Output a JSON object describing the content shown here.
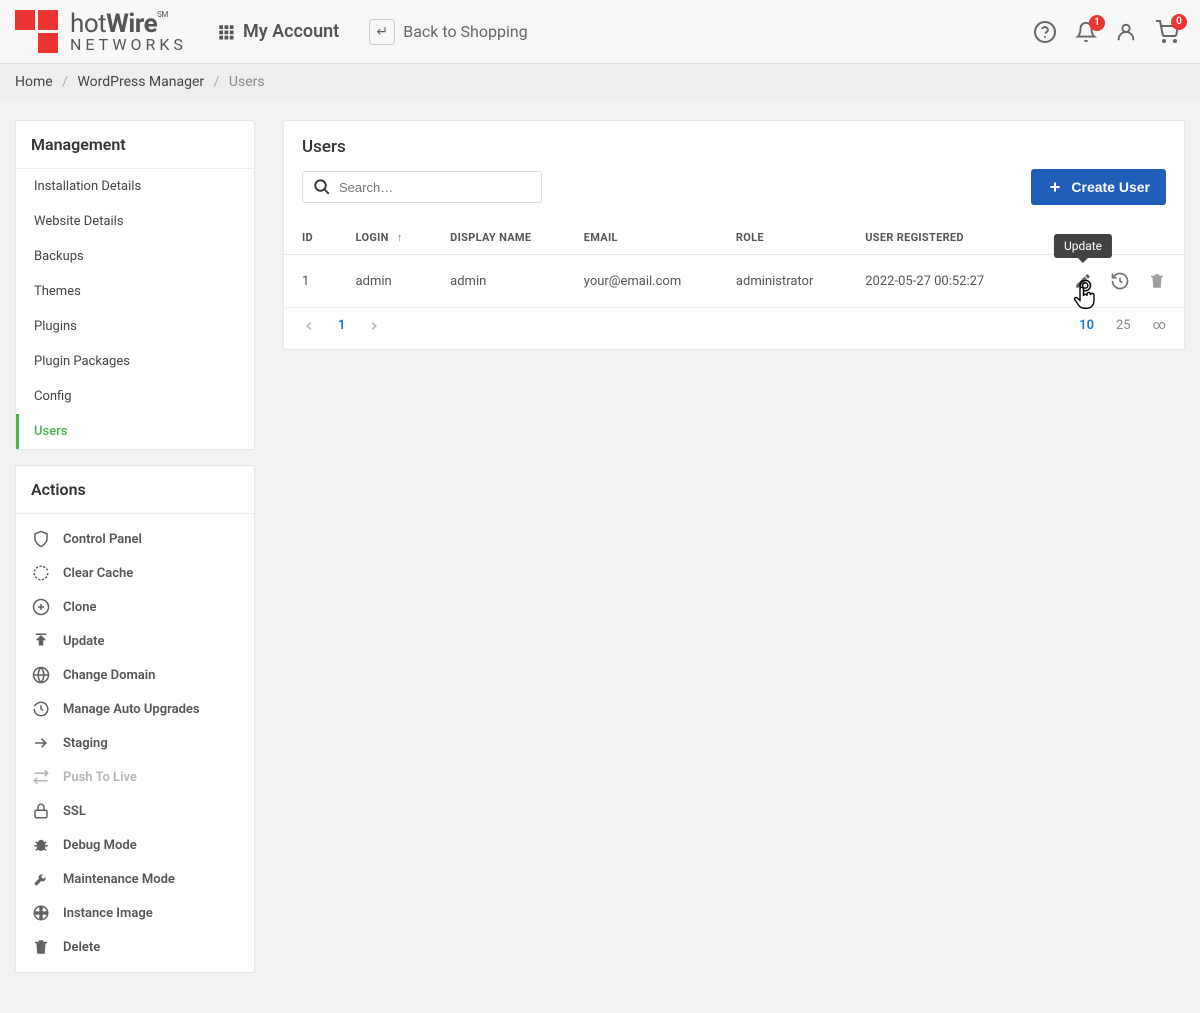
{
  "header": {
    "brand_prefix": "hot",
    "brand_bold": "Wire",
    "brand_sm": "SM",
    "brand_sub": "NETWORKS",
    "my_account": "My Account",
    "back_shopping": "Back to Shopping",
    "notif_badge": "1",
    "cart_badge": "0"
  },
  "breadcrumb": {
    "home": "Home",
    "wp_manager": "WordPress Manager",
    "users": "Users"
  },
  "sidebar": {
    "management_title": "Management",
    "items": [
      {
        "label": "Installation Details"
      },
      {
        "label": "Website Details"
      },
      {
        "label": "Backups"
      },
      {
        "label": "Themes"
      },
      {
        "label": "Plugins"
      },
      {
        "label": "Plugin Packages"
      },
      {
        "label": "Config"
      },
      {
        "label": "Users"
      }
    ],
    "actions_title": "Actions",
    "actions": [
      {
        "label": "Control Panel",
        "icon": "shield"
      },
      {
        "label": "Clear Cache",
        "icon": "refresh-dash"
      },
      {
        "label": "Clone",
        "icon": "plus-circle"
      },
      {
        "label": "Update",
        "icon": "arrow-up"
      },
      {
        "label": "Change Domain",
        "icon": "globe"
      },
      {
        "label": "Manage Auto Upgrades",
        "icon": "history"
      },
      {
        "label": "Staging",
        "icon": "arrow-right"
      },
      {
        "label": "Push To Live",
        "icon": "swap",
        "disabled": true
      },
      {
        "label": "SSL",
        "icon": "lock"
      },
      {
        "label": "Debug Mode",
        "icon": "bug"
      },
      {
        "label": "Maintenance Mode",
        "icon": "wrench"
      },
      {
        "label": "Instance Image",
        "icon": "film"
      },
      {
        "label": "Delete",
        "icon": "trash"
      }
    ]
  },
  "main": {
    "title": "Users",
    "search_placeholder": "Search…",
    "create_button": "Create User",
    "columns": {
      "id": "ID",
      "login": "LOGIN",
      "display_name": "DISPLAY NAME",
      "email": "EMAIL",
      "role": "ROLE",
      "registered": "USER REGISTERED"
    },
    "row": {
      "id": "1",
      "login": "admin",
      "display_name": "admin",
      "email": "your@email.com",
      "role": "administrator",
      "registered": "2022-05-27 00:52:27"
    },
    "tooltip_update": "Update",
    "current_page": "1",
    "page_sizes": {
      "ten": "10",
      "twentyfive": "25",
      "inf": "∞"
    }
  }
}
